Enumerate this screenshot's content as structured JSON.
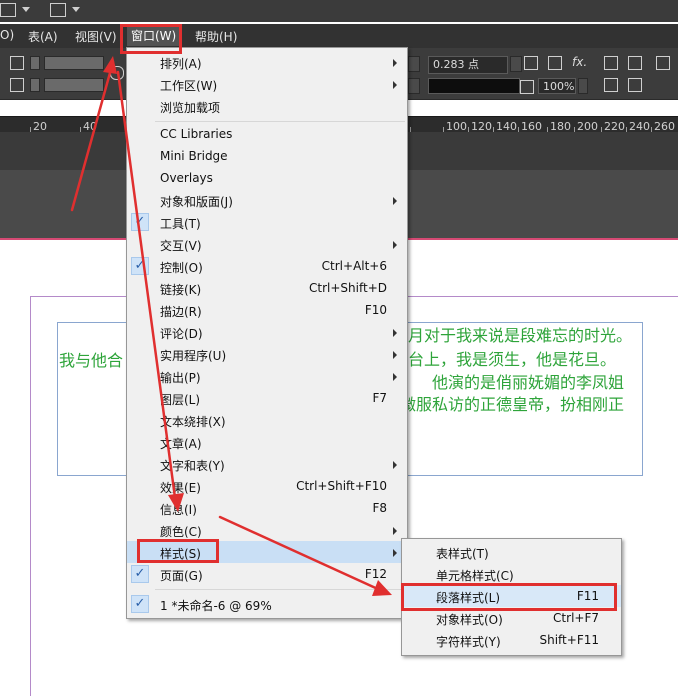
{
  "menubar": {
    "items": [
      {
        "label": "O)"
      },
      {
        "label": "表(A)"
      },
      {
        "label": "视图(V)"
      },
      {
        "label": "窗口(W)"
      },
      {
        "label": "帮助(H)"
      }
    ]
  },
  "control_panel": {
    "stroke_value": "0.283 点",
    "zoom_value": "100%",
    "fx_label": "fx."
  },
  "ruler": {
    "ticks": [
      "20",
      "40",
      "100",
      "120",
      "140",
      "160",
      "180",
      "200",
      "220",
      "240",
      "260"
    ]
  },
  "window_menu": {
    "items": [
      {
        "label": "排列(A)",
        "shortcut": "",
        "submenu": true,
        "checked": false
      },
      {
        "label": "工作区(W)",
        "shortcut": "",
        "submenu": true,
        "checked": false
      },
      {
        "label": "浏览加载项",
        "shortcut": "",
        "submenu": false,
        "checked": false
      },
      {
        "label": "CC Libraries",
        "shortcut": "",
        "submenu": false,
        "checked": false
      },
      {
        "label": "Mini Bridge",
        "shortcut": "",
        "submenu": false,
        "checked": false
      },
      {
        "label": "Overlays",
        "shortcut": "",
        "submenu": false,
        "checked": false
      },
      {
        "label": "对象和版面(J)",
        "shortcut": "",
        "submenu": true,
        "checked": false
      },
      {
        "label": "工具(T)",
        "shortcut": "",
        "submenu": false,
        "checked": true
      },
      {
        "label": "交互(V)",
        "shortcut": "",
        "submenu": true,
        "checked": false
      },
      {
        "label": "控制(O)",
        "shortcut": "Ctrl+Alt+6",
        "submenu": false,
        "checked": true
      },
      {
        "label": "链接(K)",
        "shortcut": "Ctrl+Shift+D",
        "submenu": false,
        "checked": false
      },
      {
        "label": "描边(R)",
        "shortcut": "F10",
        "submenu": false,
        "checked": false
      },
      {
        "label": "评论(D)",
        "shortcut": "",
        "submenu": true,
        "checked": false
      },
      {
        "label": "实用程序(U)",
        "shortcut": "",
        "submenu": true,
        "checked": false
      },
      {
        "label": "输出(P)",
        "shortcut": "",
        "submenu": true,
        "checked": false
      },
      {
        "label": "图层(L)",
        "shortcut": "F7",
        "submenu": false,
        "checked": false
      },
      {
        "label": "文本绕排(X)",
        "shortcut": "",
        "submenu": false,
        "checked": false
      },
      {
        "label": "文章(A)",
        "shortcut": "",
        "submenu": false,
        "checked": false
      },
      {
        "label": "文字和表(Y)",
        "shortcut": "",
        "submenu": true,
        "checked": false
      },
      {
        "label": "效果(E)",
        "shortcut": "Ctrl+Shift+F10",
        "submenu": false,
        "checked": false
      },
      {
        "label": "信息(I)",
        "shortcut": "F8",
        "submenu": false,
        "checked": false
      },
      {
        "label": "颜色(C)",
        "shortcut": "",
        "submenu": true,
        "checked": false
      },
      {
        "label": "样式(S)",
        "shortcut": "",
        "submenu": true,
        "checked": false
      },
      {
        "label": "页面(G)",
        "shortcut": "F12",
        "submenu": false,
        "checked": true
      },
      {
        "label": "1 *未命名-6 @ 69%",
        "shortcut": "",
        "submenu": false,
        "checked": true
      }
    ]
  },
  "styles_submenu": {
    "items": [
      {
        "label": "表样式(T)",
        "shortcut": ""
      },
      {
        "label": "单元格样式(C)",
        "shortcut": ""
      },
      {
        "label": "段落样式(L)",
        "shortcut": "F11"
      },
      {
        "label": "对象样式(O)",
        "shortcut": "Ctrl+F7"
      },
      {
        "label": "字符样式(Y)",
        "shortcut": "Shift+F11"
      }
    ]
  },
  "document_text": {
    "line1_left": "我与他合",
    "line1_right": "月对于我来说是段难忘的时光。",
    "line2_right": "台上，我是须生，他是花旦。",
    "line3_right": "他演的是俏丽妩媚的李凤姐",
    "line4_right": "微服私访的正德皇帝，扮相刚正"
  },
  "colors": {
    "highlight_red": "#e02f2f",
    "text_green": "#2ea43a",
    "menu_hover": "#c9dff5"
  }
}
